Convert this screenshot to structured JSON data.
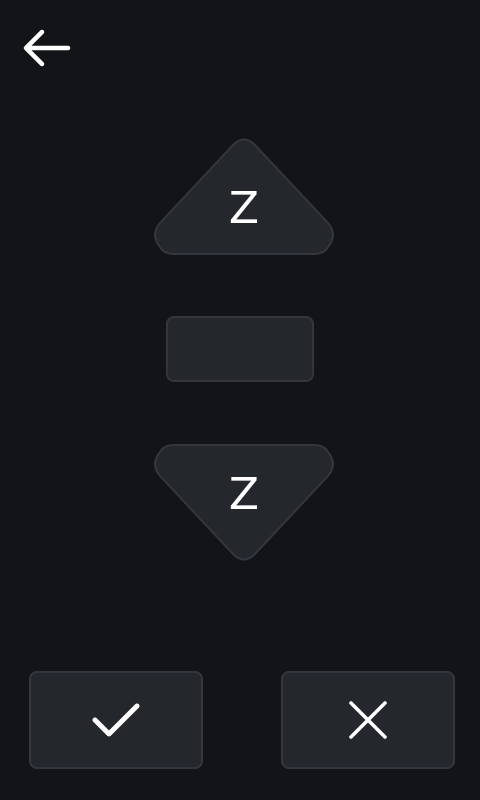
{
  "icons": {
    "back": "arrow-left-icon",
    "confirm": "check-icon",
    "cancel": "close-icon"
  },
  "jog": {
    "up_label": "Z",
    "down_label": "Z",
    "value": ""
  },
  "colors": {
    "background": "#121418",
    "button_fill": "#24272c",
    "button_border": "#33373d",
    "icon": "#ffffff"
  }
}
